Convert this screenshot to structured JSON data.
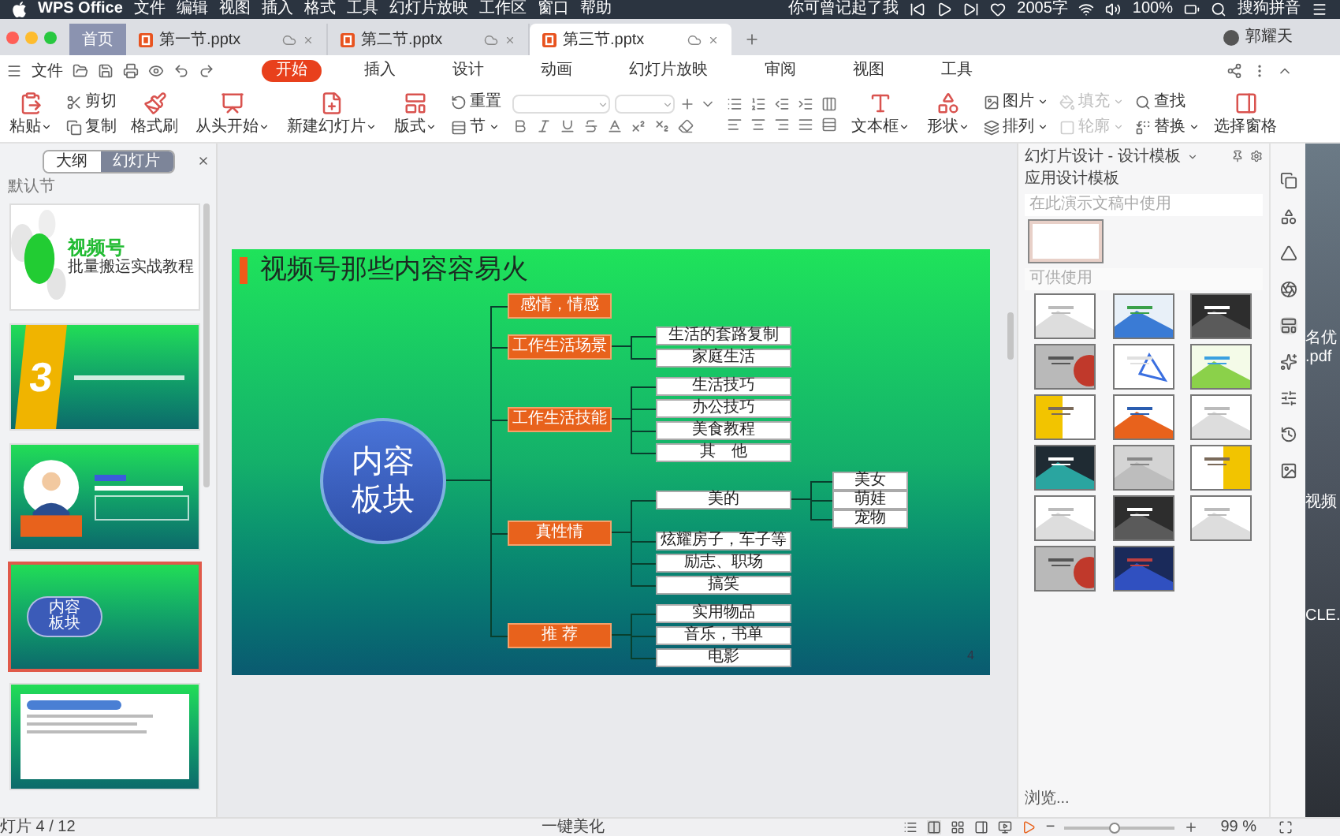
{
  "menubar": {
    "app": "WPS Office",
    "menus": [
      "文件",
      "编辑",
      "视图",
      "插入",
      "格式",
      "工具",
      "幻灯片放映",
      "工作区",
      "窗口",
      "帮助"
    ],
    "now_playing": "你可曾记起了我",
    "word_count": "2005字",
    "battery": "100%",
    "input_method": "搜狗拼音"
  },
  "doc_tabs": [
    {
      "label": "首页",
      "kind": "home",
      "selected": false
    },
    {
      "label": "第一节.pptx",
      "kind": "file",
      "selected": false
    },
    {
      "label": "第二节.pptx",
      "kind": "file",
      "selected": false
    },
    {
      "label": "第三节.pptx",
      "kind": "file",
      "selected": true
    }
  ],
  "user": "郭耀天",
  "file_menu": "文件",
  "ribbon_tabs": [
    {
      "label": "开始",
      "selected": true
    },
    {
      "label": "插入",
      "selected": false
    },
    {
      "label": "设计",
      "selected": false
    },
    {
      "label": "动画",
      "selected": false
    },
    {
      "label": "幻灯片放映",
      "selected": false
    },
    {
      "label": "审阅",
      "selected": false
    },
    {
      "label": "视图",
      "selected": false
    },
    {
      "label": "工具",
      "selected": false
    }
  ],
  "toolbar": [
    {
      "kind": "large",
      "label": "粘贴",
      "dropdown": true
    },
    {
      "kind": "pair",
      "items": [
        {
          "label": "剪切",
          "dropdown": false,
          "disabled": false
        },
        {
          "label": "复制",
          "dropdown": false,
          "disabled": false
        }
      ]
    },
    {
      "kind": "large",
      "label": "格式刷",
      "dropdown": false
    },
    {
      "kind": "large",
      "label": "从头开始",
      "dropdown": true
    },
    {
      "kind": "large",
      "label": "新建幻灯片",
      "dropdown": true
    },
    {
      "kind": "large",
      "label": "版式",
      "dropdown": true
    },
    {
      "kind": "pair",
      "items": [
        {
          "label": "重置",
          "dropdown": false,
          "disabled": false
        },
        {
          "label": "节",
          "dropdown": true,
          "disabled": false
        }
      ]
    },
    {
      "kind": "font"
    },
    {
      "kind": "paragraph"
    },
    {
      "kind": "large",
      "label": "文本框",
      "dropdown": true
    },
    {
      "kind": "large",
      "label": "形状",
      "dropdown": true
    },
    {
      "kind": "pair",
      "items": [
        {
          "label": "图片",
          "dropdown": true,
          "disabled": false
        },
        {
          "label": "排列",
          "dropdown": true,
          "disabled": false
        }
      ]
    },
    {
      "kind": "pair",
      "items": [
        {
          "label": "填充",
          "dropdown": true,
          "disabled": true
        },
        {
          "label": "轮廓",
          "dropdown": true,
          "disabled": true
        }
      ]
    },
    {
      "kind": "pair",
      "items": [
        {
          "label": "查找",
          "dropdown": false,
          "disabled": false
        },
        {
          "label": "替换",
          "dropdown": true,
          "disabled": false
        }
      ]
    },
    {
      "kind": "large",
      "label": "选择窗格",
      "dropdown": false
    }
  ],
  "outline_tabs": [
    {
      "label": "大纲",
      "selected": false
    },
    {
      "label": "幻灯片",
      "selected": true
    }
  ],
  "section": "默认节",
  "thumbnails": [
    {
      "kind": "cover",
      "title": "视频号",
      "subtitle": "批量搬运实战教程",
      "selected": false
    },
    {
      "kind": "chapter",
      "number": "3",
      "selected": false
    },
    {
      "kind": "presenter",
      "selected": false
    },
    {
      "kind": "mindmap",
      "center": "内容板块",
      "selected": true
    },
    {
      "kind": "list",
      "selected": false
    }
  ],
  "slide": {
    "title": "视频号那些内容容易火",
    "center": "内容板块",
    "page_number": "4",
    "branches": [
      {
        "label": "感情，情感"
      },
      {
        "label": "工作生活场景",
        "children": [
          {
            "label": "生活的套路复制"
          },
          {
            "label": "家庭生活"
          }
        ]
      },
      {
        "label": "工作生活技能",
        "children": [
          {
            "label": "生活技巧"
          },
          {
            "label": "办公技巧"
          },
          {
            "label": "美食教程"
          },
          {
            "label": "其　他"
          }
        ]
      },
      {
        "label": "真性情",
        "children": [
          {
            "label": "美的",
            "children": [
              {
                "label": "美女"
              },
              {
                "label": "萌娃"
              },
              {
                "label": "宠物"
              }
            ]
          },
          {
            "label": "炫耀房子，车子等"
          },
          {
            "label": "励志、职场"
          },
          {
            "label": "搞笑"
          }
        ]
      },
      {
        "label": "推 荐",
        "children": [
          {
            "label": "实用物品"
          },
          {
            "label": "音乐，书单"
          },
          {
            "label": "电影"
          }
        ]
      }
    ]
  },
  "design_pane": {
    "title": "幻灯片设计 - 设计模板",
    "section": "应用设计模板",
    "used_label": "在此演示文稿中使用",
    "available_label": "可供使用",
    "browse": "浏览...",
    "templates": [
      {
        "kind": "white"
      },
      {
        "kind": "landscape"
      },
      {
        "kind": "dark"
      },
      {
        "kind": "red"
      },
      {
        "kind": "outline"
      },
      {
        "kind": "colorful"
      },
      {
        "kind": "yellow"
      },
      {
        "kind": "stripes"
      },
      {
        "kind": "white"
      },
      {
        "kind": "teal"
      },
      {
        "kind": "gray"
      },
      {
        "kind": "yellow"
      },
      {
        "kind": "white"
      },
      {
        "kind": "dark"
      },
      {
        "kind": "white"
      },
      {
        "kind": "red"
      },
      {
        "kind": "navy"
      }
    ]
  },
  "desktop_labels": [
    "名优",
    ".pdf",
    "视频",
    "CLE."
  ],
  "status": {
    "slide_counter": "灯片 4 / 12",
    "beautify": "一键美化",
    "zoom": "99 %",
    "zoom_out": "−",
    "zoom_level": {
      "level": 0.45
    }
  }
}
